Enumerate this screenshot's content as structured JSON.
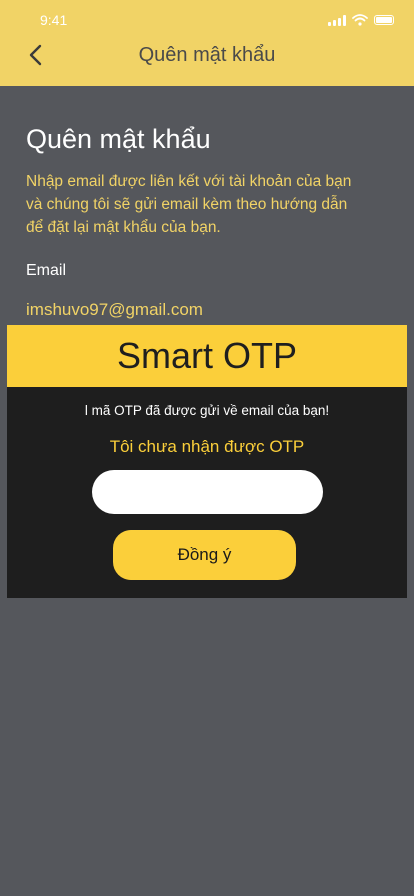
{
  "status_bar": {
    "time": "9:41"
  },
  "header": {
    "title": "Quên mật khẩu",
    "back_icon": "chevron-left-icon"
  },
  "page": {
    "title": "Quên mật khẩu",
    "description": "Nhập email được liên kết với tài khoản của bạn và chúng tôi sẽ gửi email kèm theo hướng dẫn để đặt lại mật khẩu của bạn.",
    "email_label": "Email",
    "email_value": "imshuvo97@gmail.com"
  },
  "modal": {
    "title": "Smart OTP",
    "message": "l mã OTP đã được gửi về email của bạn!",
    "resend_link": "Tôi chưa nhận được OTP",
    "otp_placeholder": "",
    "confirm_label": "Đồng ý"
  },
  "colors": {
    "background": "#55575c",
    "header": "#f1d366",
    "accent": "#fbcf3a",
    "modal_bg": "#1e1e1e"
  }
}
